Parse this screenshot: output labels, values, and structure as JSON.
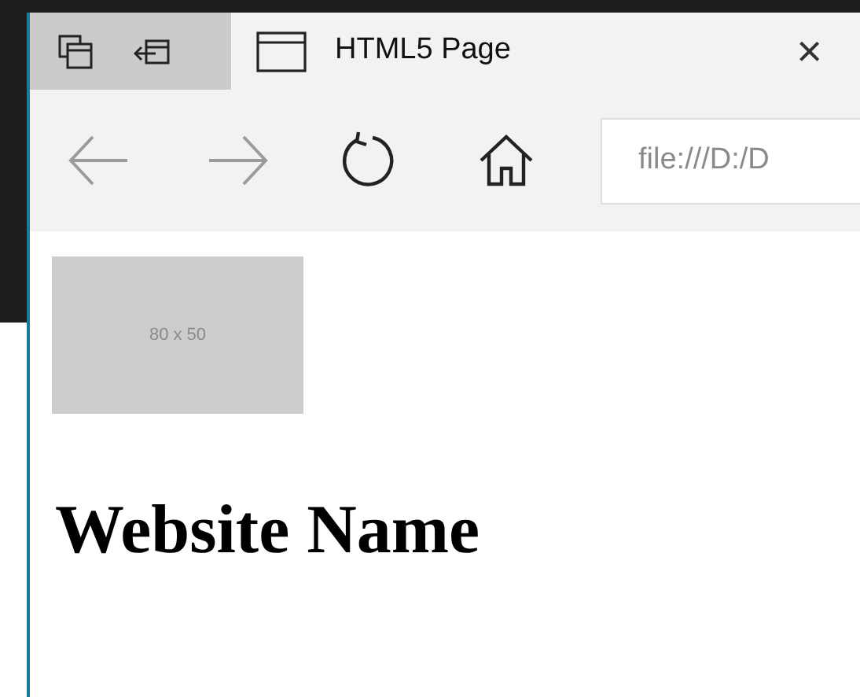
{
  "tab": {
    "title": "HTML5 Page",
    "close": "×"
  },
  "address_bar": {
    "value": "file:///D:/D"
  },
  "page": {
    "image_placeholder": "80 x 50",
    "heading": "Website Name"
  }
}
